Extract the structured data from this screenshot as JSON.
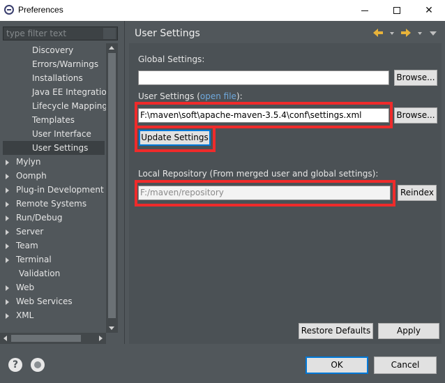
{
  "window": {
    "title": "Preferences",
    "minimize_label": "–",
    "maximize_label": "□",
    "close_label": "✕"
  },
  "filter": {
    "placeholder": "type filter text"
  },
  "tree": {
    "items": [
      {
        "label": "Discovery",
        "expandable": false,
        "selected": false
      },
      {
        "label": "Errors/Warnings",
        "expandable": false,
        "selected": false
      },
      {
        "label": "Installations",
        "expandable": false,
        "selected": false
      },
      {
        "label": "Java EE Integration",
        "expandable": false,
        "selected": false
      },
      {
        "label": "Lifecycle Mapping",
        "expandable": false,
        "selected": false
      },
      {
        "label": "Templates",
        "expandable": false,
        "selected": false
      },
      {
        "label": "User Interface",
        "expandable": false,
        "selected": false
      },
      {
        "label": "User Settings",
        "expandable": false,
        "selected": true
      },
      {
        "label": "Mylyn",
        "expandable": true,
        "selected": false
      },
      {
        "label": "Oomph",
        "expandable": true,
        "selected": false
      },
      {
        "label": "Plug-in Development",
        "expandable": true,
        "selected": false
      },
      {
        "label": "Remote Systems",
        "expandable": true,
        "selected": false
      },
      {
        "label": "Run/Debug",
        "expandable": true,
        "selected": false
      },
      {
        "label": "Server",
        "expandable": true,
        "selected": false
      },
      {
        "label": "Team",
        "expandable": true,
        "selected": false
      },
      {
        "label": "Terminal",
        "expandable": true,
        "selected": false
      },
      {
        "label": "Validation",
        "expandable": false,
        "selected": false
      },
      {
        "label": "Web",
        "expandable": true,
        "selected": false
      },
      {
        "label": "Web Services",
        "expandable": true,
        "selected": false
      },
      {
        "label": "XML",
        "expandable": true,
        "selected": false
      }
    ]
  },
  "page": {
    "title": "User Settings",
    "global_settings_label": "Global Settings:",
    "global_settings_value": "",
    "user_settings_label": "User Settings (",
    "user_settings_link": "open file",
    "user_settings_label_end": "):",
    "user_settings_value": "F:\\maven\\soft\\apache-maven-3.5.4\\conf\\settings.xml",
    "browse_label": "Browse...",
    "update_settings_label": "Update Settings",
    "local_repo_label": "Local Repository (From merged user and global settings):",
    "local_repo_value": "F:/maven/repository",
    "reindex_label": "Reindex",
    "restore_defaults_label": "Restore Defaults",
    "apply_label": "Apply"
  },
  "footer": {
    "help_icon_label": "?",
    "ok_label": "OK",
    "cancel_label": "Cancel"
  },
  "colors": {
    "highlight": "#ef2b2b",
    "accent": "#0078d7",
    "background": "#51575b",
    "nav_arrow": "#e8b33a"
  }
}
